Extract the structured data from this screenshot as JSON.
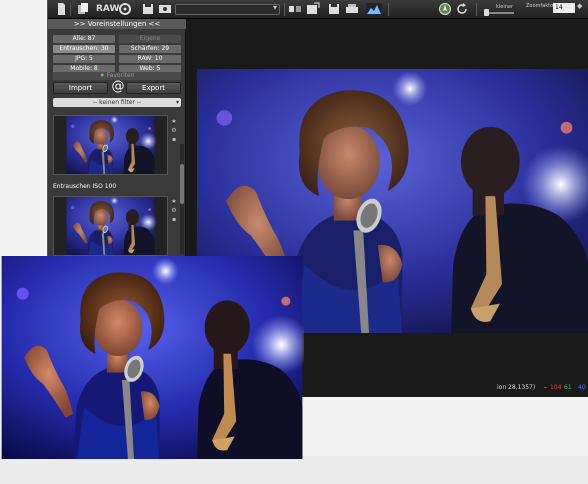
{
  "toolbar": {
    "raw_label": "RAW",
    "zoom_label": "Zoomfaktor",
    "zoom_value": "14",
    "slider_label": "kleiner"
  },
  "panel": {
    "header": ">> Voreinstellungen <<",
    "chips": [
      {
        "label": "Alle: 87",
        "state": "normal"
      },
      {
        "label": "Eigene",
        "state": "dim"
      },
      {
        "label": "Entrauschen: 30",
        "state": "selected"
      },
      {
        "label": "Schärfen: 29",
        "state": "normal"
      },
      {
        "label": "JPG: 5",
        "state": "normal"
      },
      {
        "label": "RAW: 10",
        "state": "normal"
      },
      {
        "label": "Mobile: 8",
        "state": "normal"
      },
      {
        "label": "Web: 5",
        "state": "normal"
      }
    ],
    "favorites": "Favoriten",
    "import_label": "Import",
    "at_symbol": "@",
    "export_label": "Export",
    "filter_value": "-- keinen filter --",
    "section_title": "Entrauschen ISO 100"
  },
  "status": {
    "position_text": "ion  28,1357)",
    "dash": "–",
    "r_value": "104",
    "g_value": "61",
    "b_value": "40",
    "colors": {
      "r": "#e23b3b",
      "g": "#3fc24a",
      "b": "#4a6cff"
    }
  },
  "icons": [
    "new-file-icon",
    "copy-icon",
    "raw-icon",
    "settings-icon",
    "save-icon",
    "photo-icon",
    "dropdown-arrow-icon",
    "compare-icon",
    "export-icon",
    "print-icon",
    "histogram-icon",
    "navigator-icon",
    "refresh-icon",
    "star-icon",
    "trash-icon"
  ]
}
